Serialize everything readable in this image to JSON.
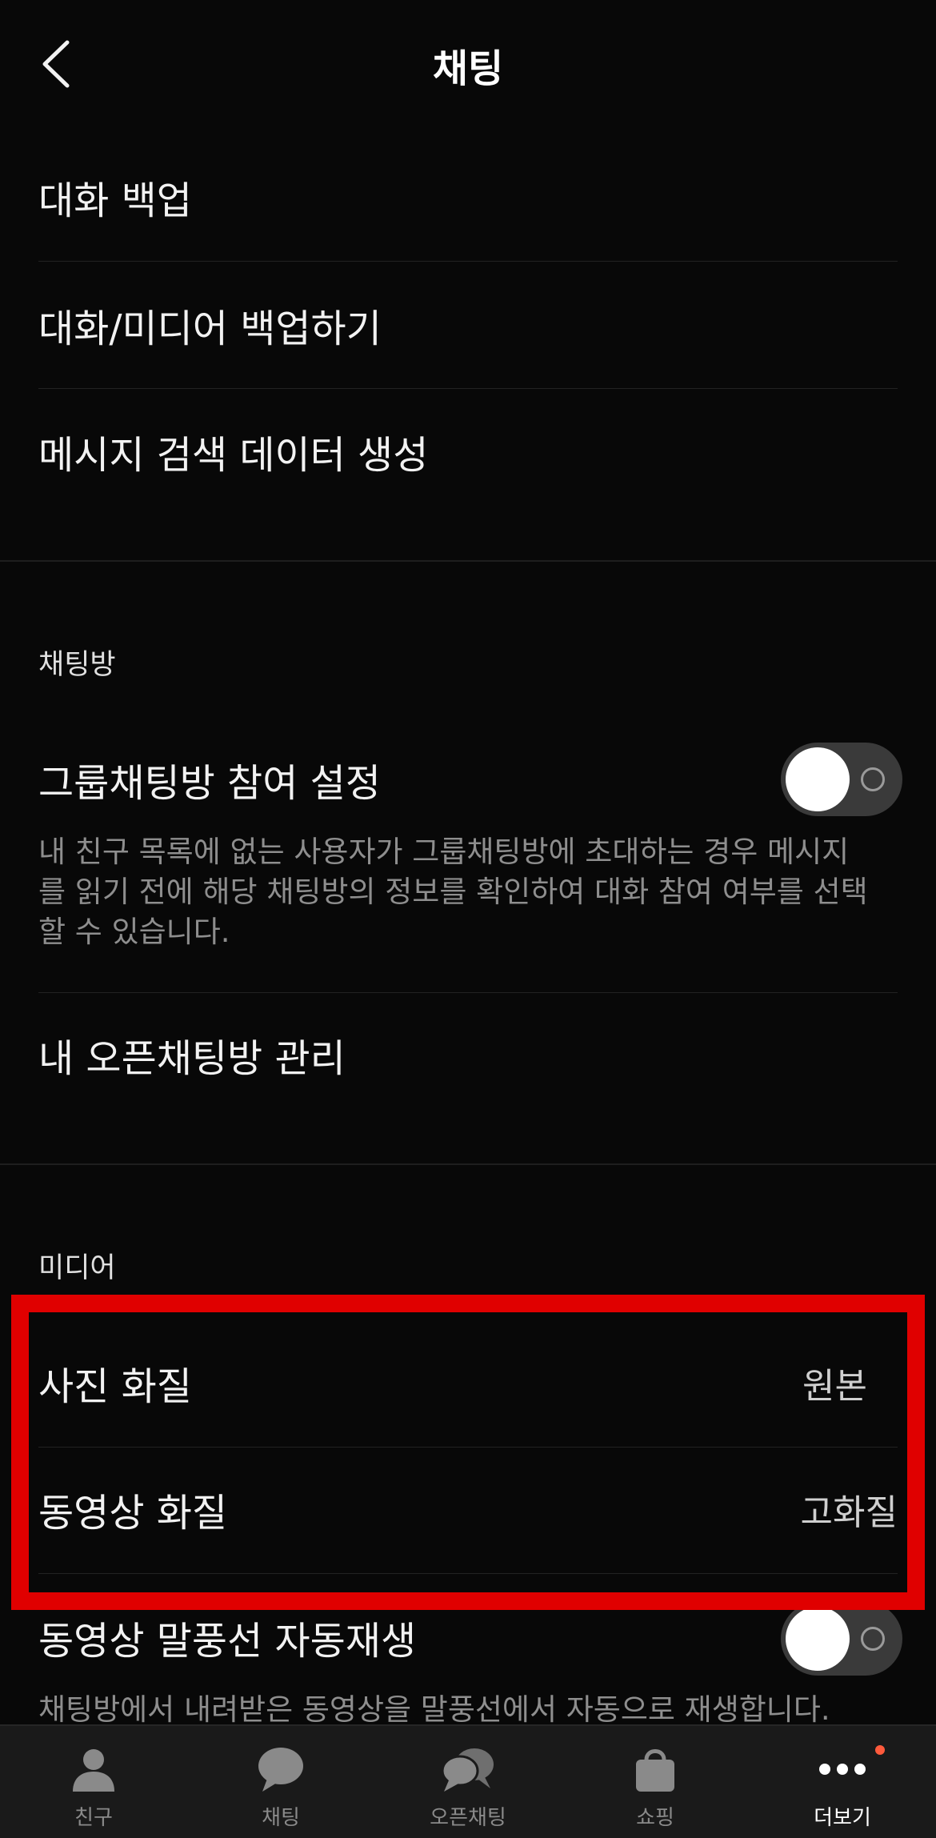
{
  "header": {
    "title": "채팅",
    "back_icon": "chevron-left-icon"
  },
  "backup": {
    "items": [
      {
        "label": "대화 백업"
      },
      {
        "label": "대화/미디어 백업하기"
      },
      {
        "label": "메시지 검색 데이터 생성"
      }
    ]
  },
  "chatroom": {
    "section_title": "채팅방",
    "group_join": {
      "label": "그룹채팅방 참여 설정",
      "enabled": true,
      "description": "내 친구 목록에 없는 사용자가 그룹채팅방에 초대하는 경우 메시지를 읽기 전에 해당 채팅방의 정보를 확인하여 대화 참여 여부를 선택할 수 있습니다."
    },
    "open_manage": {
      "label": "내 오픈채팅방 관리"
    }
  },
  "media": {
    "section_title": "미디어",
    "photo_quality": {
      "label": "사진 화질",
      "value": "원본"
    },
    "video_quality": {
      "label": "동영상 화질",
      "value": "고화질"
    },
    "autoplay": {
      "label": "동영상 말풍선 자동재생",
      "enabled": true,
      "description": "채팅방에서 내려받은 동영상을 말풍선에서 자동으로 재생합니다."
    }
  },
  "highlight_color": "#e00000",
  "tabbar": {
    "tabs": [
      {
        "label": "친구",
        "icon": "person-icon"
      },
      {
        "label": "채팅",
        "icon": "chat-bubble-icon"
      },
      {
        "label": "오픈채팅",
        "icon": "open-chat-icon"
      },
      {
        "label": "쇼핑",
        "icon": "shopping-bag-icon"
      },
      {
        "label": "더보기",
        "icon": "more-dots-icon",
        "active": true,
        "has_badge": true
      }
    ]
  }
}
